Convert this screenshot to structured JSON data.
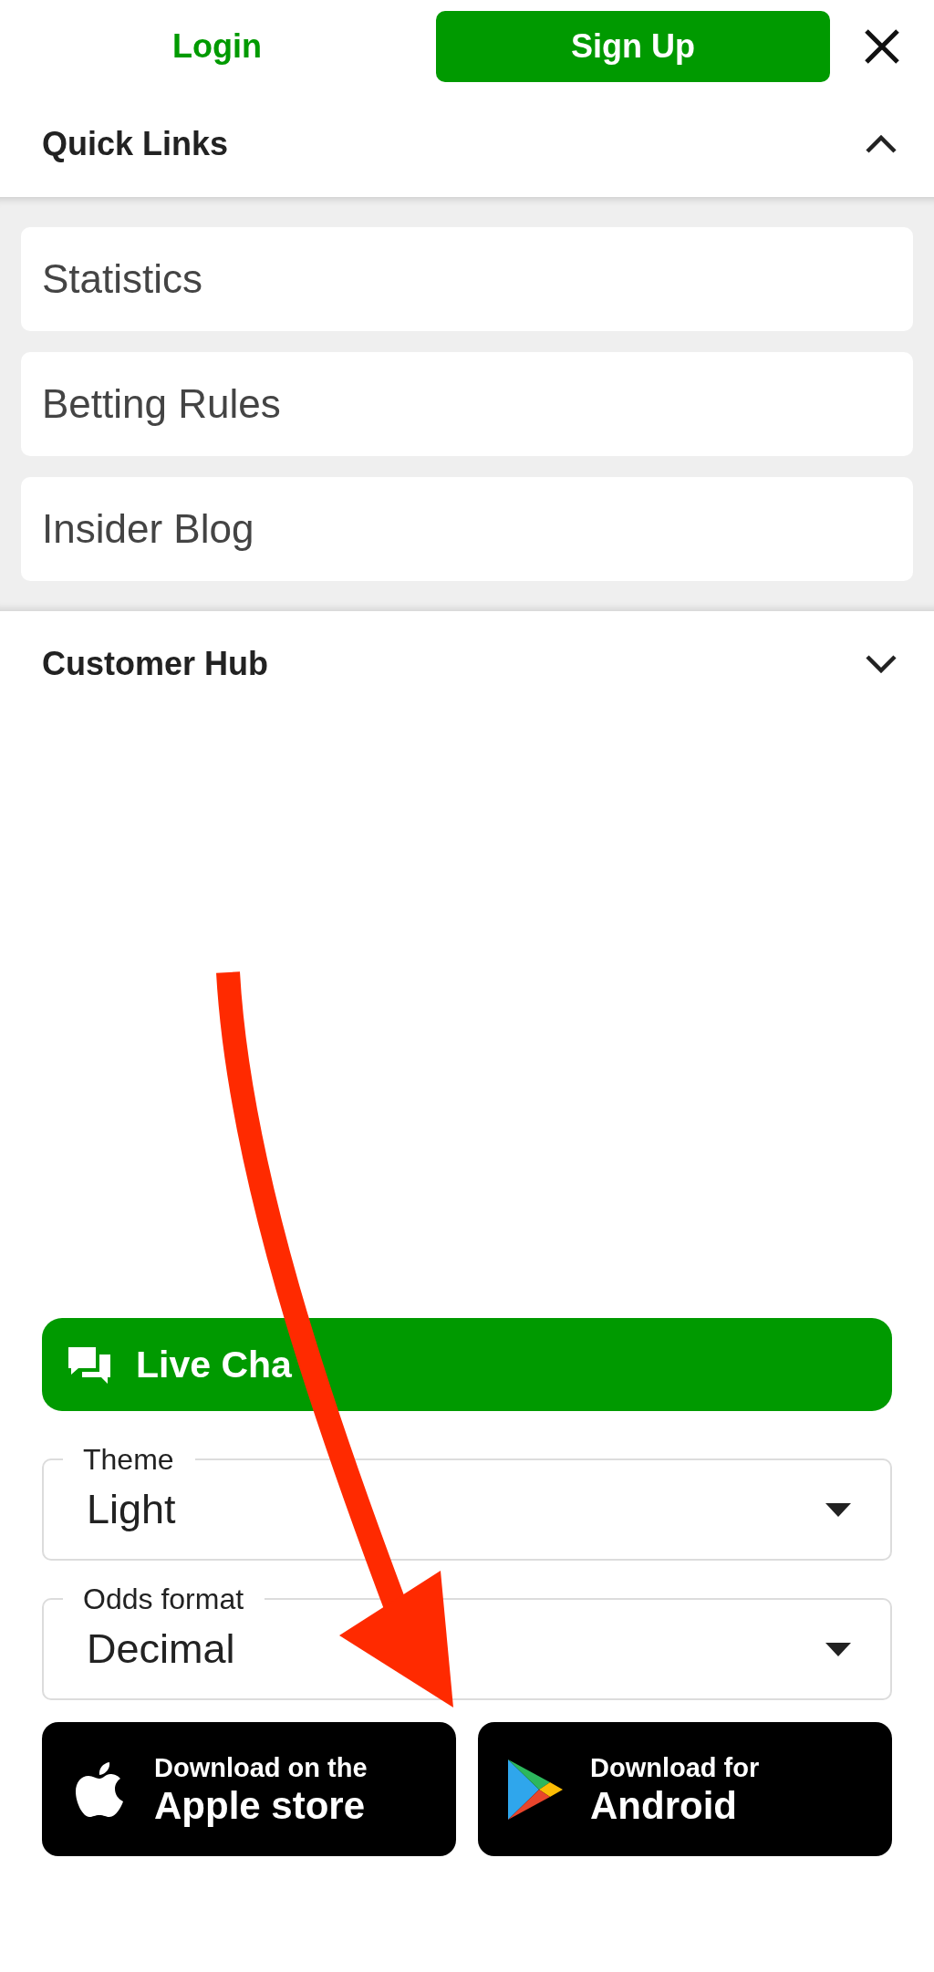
{
  "header": {
    "login": "Login",
    "signup": "Sign Up"
  },
  "sections": [
    {
      "title": "Quick Links",
      "expanded": true,
      "items": [
        {
          "label": "Statistics"
        },
        {
          "label": "Betting Rules"
        },
        {
          "label": "Insider Blog"
        }
      ]
    },
    {
      "title": "Customer Hub",
      "expanded": false
    }
  ],
  "live_chat": {
    "label": "Live Cha"
  },
  "selects": [
    {
      "label": "Theme",
      "value": "Light"
    },
    {
      "label": "Odds format",
      "value": "Decimal"
    }
  ],
  "downloads": [
    {
      "kind": "apple",
      "line_1": "Download on the",
      "line_2": "Apple store"
    },
    {
      "kind": "android",
      "line_1": "Download for",
      "line_2": "Android"
    }
  ]
}
